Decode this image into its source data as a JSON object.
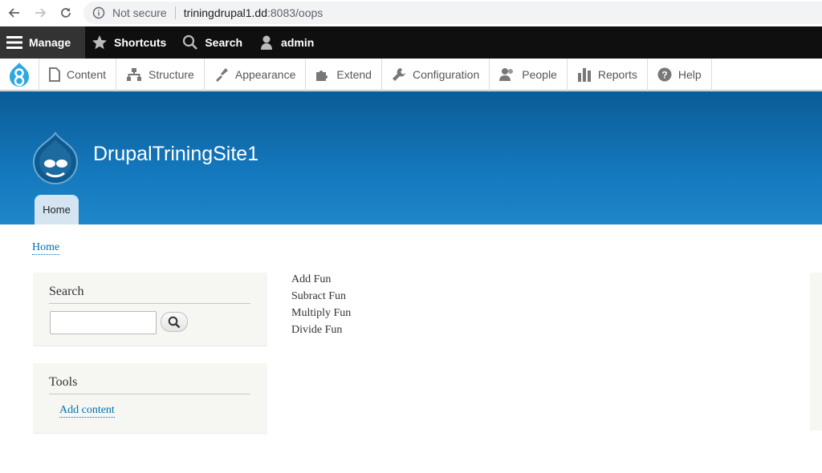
{
  "browser": {
    "security_label": "Not secure",
    "url_host": "triningdrupal1.dd",
    "url_path": ":8083/oops"
  },
  "toolbar": {
    "manage": "Manage",
    "shortcuts": "Shortcuts",
    "search": "Search",
    "user": "admin"
  },
  "admin_menu": {
    "items": [
      {
        "label": "Content",
        "icon": "file-icon"
      },
      {
        "label": "Structure",
        "icon": "sitemap-icon"
      },
      {
        "label": "Appearance",
        "icon": "brush-icon"
      },
      {
        "label": "Extend",
        "icon": "puzzle-icon"
      },
      {
        "label": "Configuration",
        "icon": "wrench-icon"
      },
      {
        "label": "People",
        "icon": "people-icon"
      },
      {
        "label": "Reports",
        "icon": "bar-chart-icon"
      },
      {
        "label": "Help",
        "icon": "help-icon"
      }
    ]
  },
  "header": {
    "site_name": "DrupalTriningSite1",
    "home_tab": "Home"
  },
  "breadcrumb": "Home",
  "search_block": {
    "title": "Search",
    "input_value": ""
  },
  "tools_block": {
    "title": "Tools",
    "link": "Add content"
  },
  "main": {
    "links": [
      "Add Fun",
      "Subract Fun",
      "Multiply Fun",
      "Divide Fun"
    ]
  },
  "colors": {
    "toolbar_bg": "#0f0f0f",
    "banner_top": "#0b5c96",
    "banner_bottom": "#1f86c9",
    "link": "#0071b3"
  }
}
